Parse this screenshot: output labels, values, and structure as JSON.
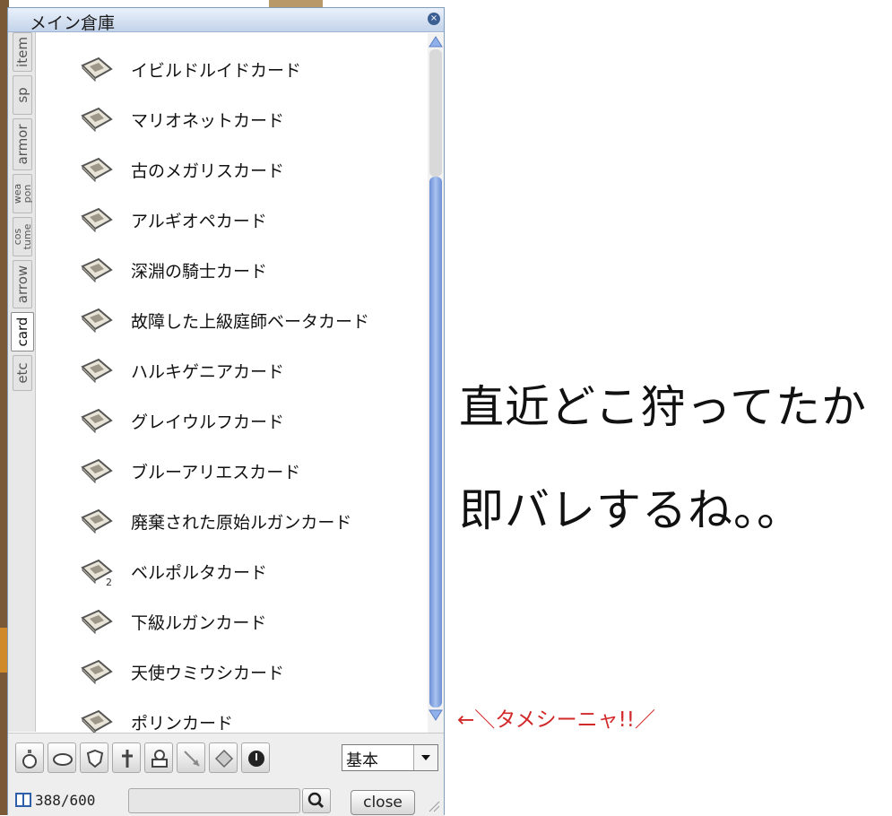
{
  "window": {
    "title": "メイン倉庫"
  },
  "tabs": [
    {
      "label": "item",
      "active": false
    },
    {
      "label": "sp",
      "active": false
    },
    {
      "label": "armor",
      "active": false
    },
    {
      "label": "wea\npon",
      "active": false
    },
    {
      "label": "cos\ntume",
      "active": false
    },
    {
      "label": "arrow",
      "active": false
    },
    {
      "label": "card",
      "active": true
    },
    {
      "label": "etc",
      "active": false
    }
  ],
  "items": [
    {
      "name": "イビルドルイドカード",
      "count": ""
    },
    {
      "name": "マリオネットカード",
      "count": ""
    },
    {
      "name": "古のメガリスカード",
      "count": ""
    },
    {
      "name": "アルギオペカード",
      "count": ""
    },
    {
      "name": "深淵の騎士カード",
      "count": ""
    },
    {
      "name": "故障した上級庭師ベータカード",
      "count": ""
    },
    {
      "name": "ハルキゲニアカード",
      "count": ""
    },
    {
      "name": "グレイウルフカード",
      "count": ""
    },
    {
      "name": "ブルーアリエスカード",
      "count": ""
    },
    {
      "name": "廃棄された原始ルガンカード",
      "count": ""
    },
    {
      "name": "ベルポルタカード",
      "count": "2"
    },
    {
      "name": "下級ルガンカード",
      "count": ""
    },
    {
      "name": "天使ウミウシカード",
      "count": ""
    },
    {
      "name": "ポリンカード",
      "count": ""
    }
  ],
  "toolbar": {
    "filters": [
      "potion-icon",
      "oval-icon",
      "shield-icon",
      "sword-icon",
      "costume-icon",
      "arrow-icon",
      "card-icon",
      "etc-icon"
    ],
    "view_select": "基本"
  },
  "status": {
    "capacity": "388/600",
    "search_placeholder": "",
    "close_label": "close"
  },
  "scroll": {
    "position": 1.0
  },
  "caption": {
    "line1": "直近どこ狩ってたか",
    "line2": "即バレするね。。"
  },
  "annotation": "←＼タメシーニャ!!／",
  "colors": {
    "annotation": "#d22a2a",
    "scroll_thumb": "#6b8fd6",
    "title_bar": "#c3d3ea"
  }
}
